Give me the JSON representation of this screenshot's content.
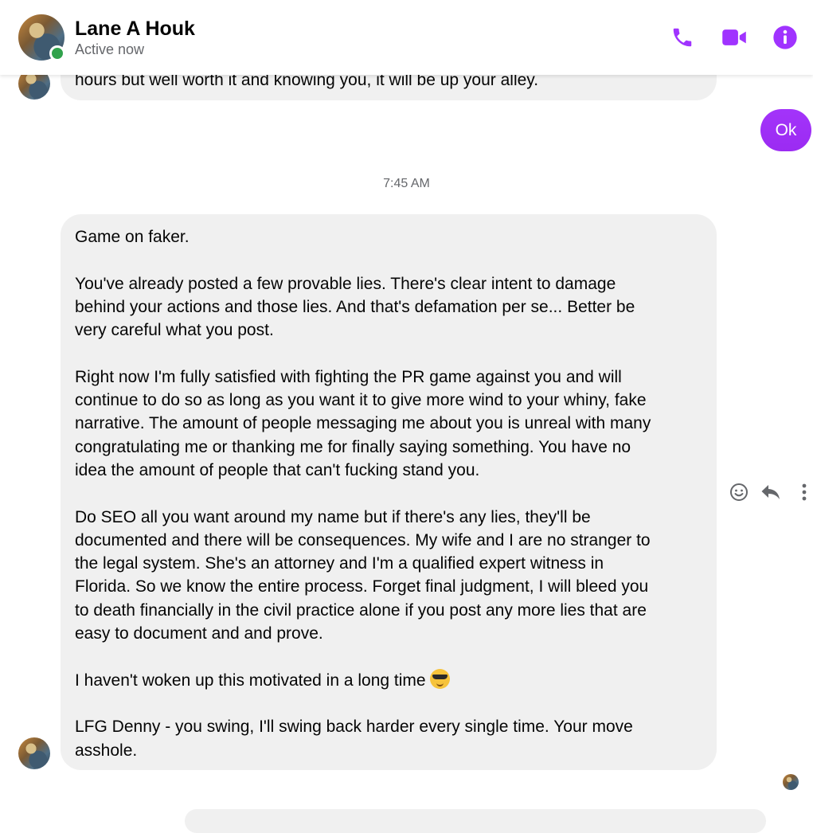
{
  "header": {
    "contact_name": "Lane A Houk",
    "status": "Active now",
    "accent_color": "#a033ff",
    "icons": [
      "phone-icon",
      "video-camera-icon",
      "info-icon"
    ]
  },
  "messages": {
    "prev_incoming_tail": "hours but well worth it and knowing you, it will be up your alley.",
    "outgoing": "Ok",
    "timestamp": "7:45 AM",
    "main": {
      "p1": "Game on faker.",
      "p2": "You've already posted a few provable lies. There's clear intent to damage\nbehind your actions and those  lies. And that's defamation per se... Better be\nvery careful what you post.",
      "p3": "Right now I'm fully satisfied with fighting the PR game against you and will\ncontinue to do so as long as you want it to give more wind to your whiny, fake\nnarrative. The amount of people messaging me about you is unreal with many\ncongratulating me or thanking me for finally saying something. You have no\nidea the amount of people that can't fucking stand you.",
      "p4": "Do SEO all you want around my name but if there's any lies, they'll be\ndocumented and there will be consequences. My wife and I are no stranger to\nthe legal system. She's an attorney and I'm a qualified expert witness in\nFlorida. So we know the entire process. Forget final judgment, I will bleed you\nto death financially in the civil practice alone if you post any more lies that are\neasy to document and and prove.",
      "p5": "I haven't woken up this motivated in a long time",
      "p5_emoji": "smiling-face-with-sunglasses-emoji",
      "p6": "LFG Denny - you swing, I'll swing back harder every single time. Your move\nasshole."
    },
    "message_actions": [
      "react-icon",
      "reply-icon",
      "more-icon"
    ]
  }
}
